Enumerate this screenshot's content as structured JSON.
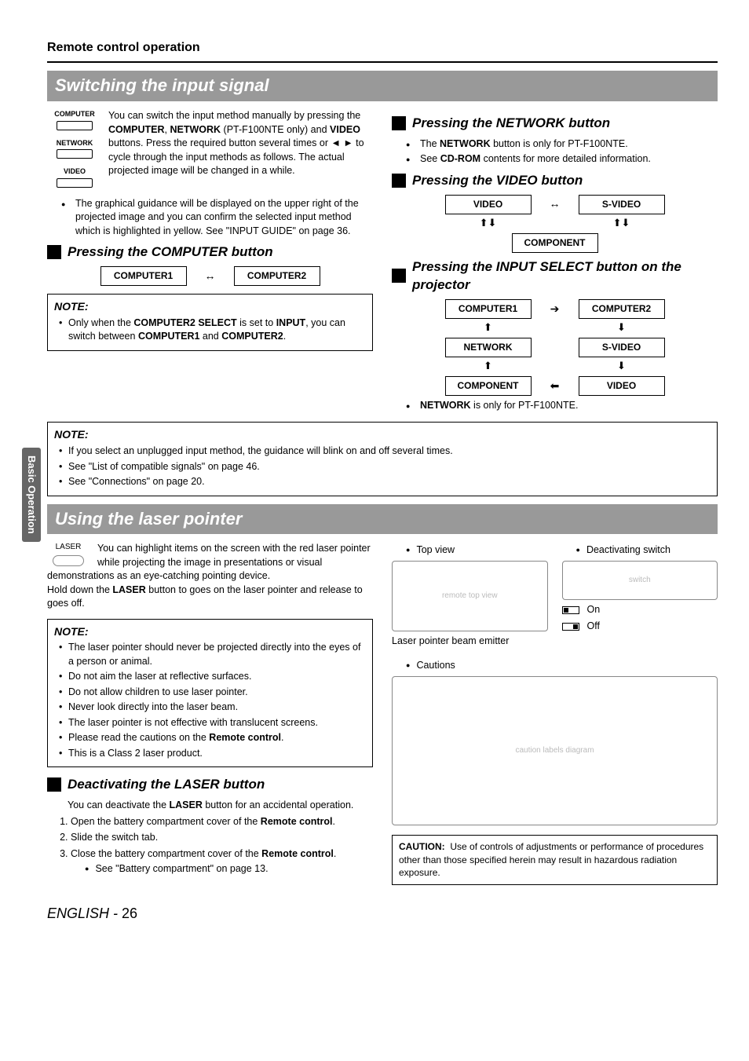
{
  "sideTab": "Basic Operation",
  "sectionHead": "Remote control operation",
  "switching": {
    "barTitle": "Switching the input signal",
    "remoteLabels": {
      "computer": "COMPUTER",
      "network": "NETWORK",
      "video": "VIDEO"
    },
    "intro1": "You can switch the input method manually by pressing the ",
    "b1": "COMPUTER",
    "sep1": ", ",
    "b2": "NETWORK",
    "intro2": " (PT-F100NTE only) and ",
    "b3": "VIDEO",
    "intro3": " buttons. Press the required button several times or ◄ ► to cycle through the input methods as follows. The actual projected image will be changed in a while.",
    "bullet1a": "The graphical guidance will be displayed on the upper right of the projected image and you can confirm the selected input method which is highlighted in yellow. See \"INPUT GUIDE\" on page 36.",
    "hComputer": "Pressing the COMPUTER button",
    "flowComp": {
      "a": "COMPUTER1",
      "b": "COMPUTER2"
    },
    "note1": {
      "title": "NOTE:",
      "text1": "Only when the ",
      "b1": "COMPUTER2 SELECT",
      "text2": " is set to ",
      "b2": "INPUT",
      "text3": ", you can switch between ",
      "b3": "COMPUTER1",
      "text4": " and ",
      "b4": "COMPUTER2",
      "text5": "."
    },
    "hNetwork": "Pressing the NETWORK button",
    "netBul1a": "The ",
    "netBul1b": "NETWORK",
    "netBul1c": " button is only for PT-F100NTE.",
    "netBul2a": "See ",
    "netBul2b": "CD-ROM",
    "netBul2c": " contents for more detailed information.",
    "hVideo": "Pressing the VIDEO button",
    "flowVid": {
      "a": "VIDEO",
      "b": "S-VIDEO",
      "c": "COMPONENT"
    },
    "hInputSel": "Pressing the INPUT SELECT button on the projector",
    "flowSel": {
      "r1a": "COMPUTER1",
      "r1b": "COMPUTER2",
      "r2a": "NETWORK",
      "r2b": "S-VIDEO",
      "r3a": "COMPONENT",
      "r3b": "VIDEO"
    },
    "selBul1a": "NETWORK",
    "selBul1b": " is only for PT-F100NTE.",
    "note2": {
      "title": "NOTE:",
      "li1": "If you select an unplugged input method, the guidance will blink on and off several times.",
      "li2": "See \"List of compatible signals\" on page 46.",
      "li3": "See \"Connections\" on page 20."
    }
  },
  "laser": {
    "barTitle": "Using the laser pointer",
    "iconLabel": "LASER",
    "intro1": "You can highlight items on the screen with the red laser pointer while projecting the image in presentations or visual demonstrations as an eye-catching pointing device.",
    "intro2a": "Hold down the ",
    "intro2b": "LASER",
    "intro2c": " button to goes on the laser pointer and release to goes off.",
    "note": {
      "title": "NOTE:",
      "li1": "The laser pointer should never be projected directly into the eyes of a person or animal.",
      "li2": "Do not aim the laser at reflective surfaces.",
      "li3": "Do not allow children to use laser pointer.",
      "li4": "Never look directly into the laser beam.",
      "li5": "The laser pointer is not effective with translucent screens.",
      "li6a": "Please read the cautions on the ",
      "li6b": "Remote control",
      "li6c": ".",
      "li7": "This is a Class 2 laser product."
    },
    "hDeact": "Deactivating the LASER button",
    "deactIntro1": "You can deactivate the ",
    "deactIntro2": "LASER",
    "deactIntro3": " button for an accidental operation.",
    "step1a": "Open the battery compartment cover of the ",
    "step1b": "Remote control",
    "step1c": ".",
    "step2": "Slide the switch tab.",
    "step3a": "Close the battery compartment cover of the ",
    "step3b": "Remote control",
    "step3c": ".",
    "step3sub": "See \"Battery compartment\" on page 13.",
    "rTop": "Top view",
    "rDeact": "Deactivating switch",
    "rOn": "On",
    "rOff": "Off",
    "rEmitter": "Laser pointer beam emitter",
    "rCautions": "Cautions",
    "cautionLabel": "CAUTION:",
    "cautionText": "Use of controls of adjustments or performance of procedures other than those specified herein may result in hazardous radiation exposure."
  },
  "footer": {
    "lang": "ENGLISH",
    "sep": " - ",
    "page": "26"
  }
}
